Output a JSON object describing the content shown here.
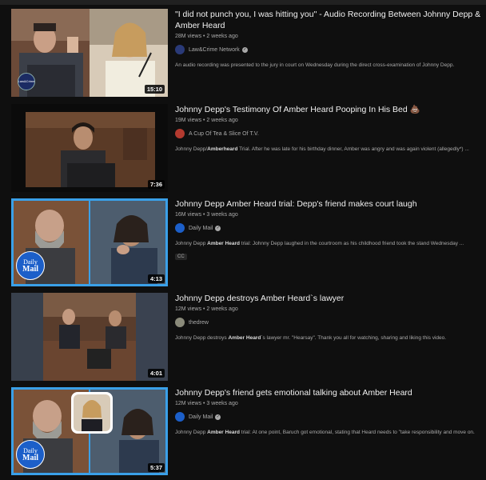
{
  "videos": [
    {
      "title": "\"I did not punch you, I was hitting you\" - Audio Recording Between Johnny Depp & Amber Heard",
      "views": "28M views",
      "age": "2 weeks ago",
      "channel": "Law&Crime Network",
      "verified": true,
      "description": "An audio recording was presented to the jury in court on Wednesday during the direct cross-examination of Johnny Depp.",
      "duration": "15:10",
      "thumb_badge_text": "Law&Crime"
    },
    {
      "title": "Johnny Depp's Testimony Of Amber Heard Pooping In His Bed 💩",
      "views": "19M views",
      "age": "2 weeks ago",
      "channel": "A Cup Of Tea & Slice Of T.V.",
      "verified": false,
      "description_pre": "Johnny Depp/",
      "description_bold": "Amberheard",
      "description_post": " Trial. After he was late for his birthday dinner, Amber was angry and was again violent (allegedly*) ...",
      "duration": "7:36"
    },
    {
      "title": "Johnny Depp Amber Heard trial: Depp's friend makes court laugh",
      "views": "16M views",
      "age": "3 weeks ago",
      "channel": "Daily Mail",
      "verified": true,
      "description_pre": "Johnny Depp ",
      "description_bold": "Amber Heard",
      "description_post": " trial: Johnny Depp laughed in the courtroom as his childhood friend took the stand Wednesday ...",
      "cc": "CC",
      "duration": "4:13",
      "thumb_badge_line1": "Daily",
      "thumb_badge_line2": "Mail"
    },
    {
      "title": "Johnny Depp destroys Amber Heard`s lawyer",
      "views": "12M views",
      "age": "2 weeks ago",
      "channel": "thedrew",
      "verified": false,
      "description_pre": "Johnny Depp destroys ",
      "description_bold": "Amber Heard",
      "description_post": "`s lawyer mr. \"Hearsay\". Thank you all for watching, sharing and liking this video.",
      "duration": "4:01"
    },
    {
      "title": "Johnny Depp's friend gets emotional talking about Amber Heard",
      "views": "12M views",
      "age": "3 weeks ago",
      "channel": "Daily Mail",
      "verified": true,
      "description_pre": "Johnny Depp ",
      "description_bold": "Amber Heard",
      "description_post": " trial: At one point, Baruch got emotional, stating that Heard needs to \"take responsibility and move on.",
      "duration": "5:37",
      "thumb_badge_line1": "Daily",
      "thumb_badge_line2": "Mail"
    }
  ],
  "meta_separator": " • ",
  "verified_glyph": "✓",
  "colors": {
    "background": "#0f0f0f",
    "title": "#f1f1f1",
    "secondary": "#aaaaaa",
    "daily_mail_blue": "#1c5fc9",
    "thumb_border": "#3aa0e8"
  },
  "icons": {
    "verified": "check-circle-icon",
    "channel_avatar": "avatar"
  }
}
